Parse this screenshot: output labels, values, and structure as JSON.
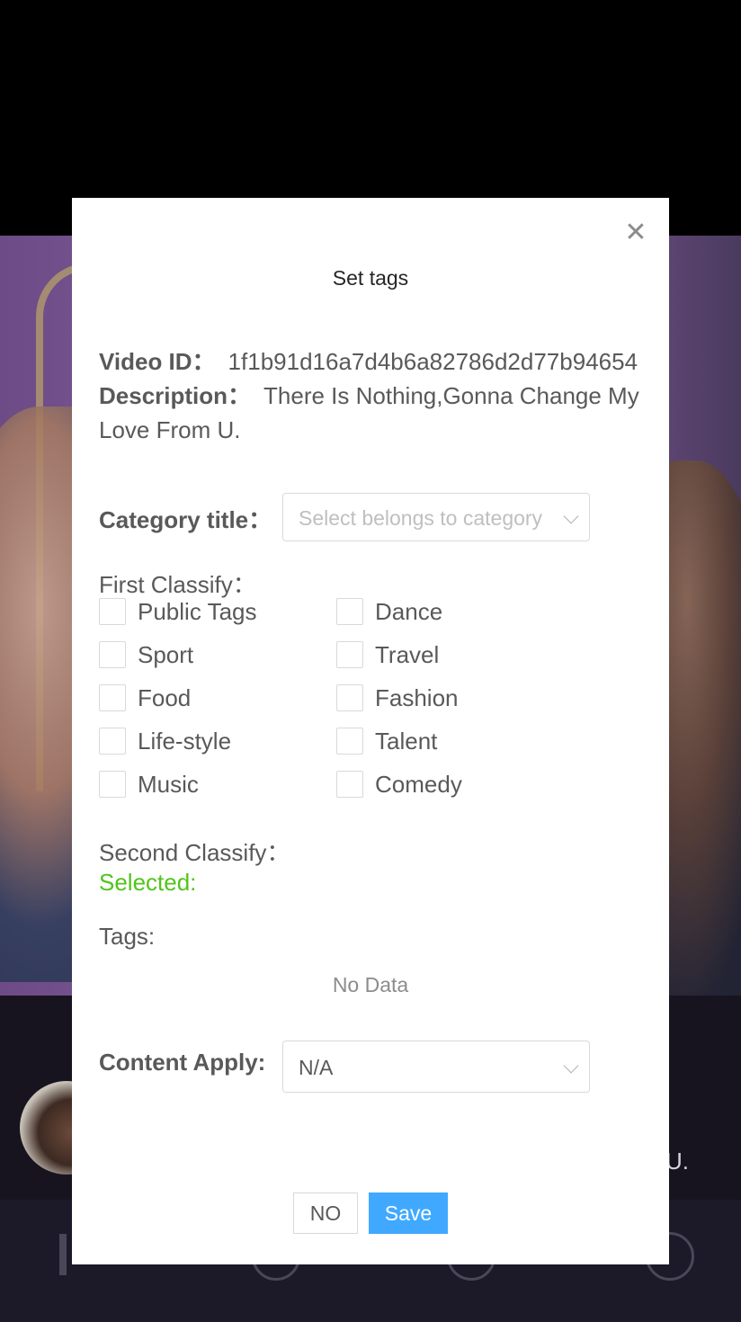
{
  "background": {
    "caption_fragment": "U."
  },
  "modal": {
    "title": "Set tags",
    "close_icon": "close-icon",
    "video_id_label": "Video ID：",
    "video_id_value": "1f1b91d16a7d4b6a82786d2d77b94654",
    "description_label": "Description：",
    "description_value": "There Is Nothing,Gonna Change My Love From U.",
    "category_label": "Category title：",
    "category_placeholder": "Select belongs to category",
    "first_classify_label": "First Classify：",
    "first_classify_options": [
      "Public Tags",
      "Dance",
      "Sport",
      "Travel",
      "Food",
      "Fashion",
      "Life-style",
      "Talent",
      "Music",
      "Comedy"
    ],
    "second_classify_label": "Second Classify：",
    "selected_label": "Selected:",
    "tags_label": "Tags:",
    "no_data_text": "No Data",
    "content_apply_label": "Content Apply:",
    "content_apply_value": "N/A",
    "no_button": "NO",
    "save_button": "Save"
  },
  "colors": {
    "primary": "#40a9ff",
    "success": "#52c41a",
    "text": "#595959",
    "border": "#d9d9d9"
  }
}
